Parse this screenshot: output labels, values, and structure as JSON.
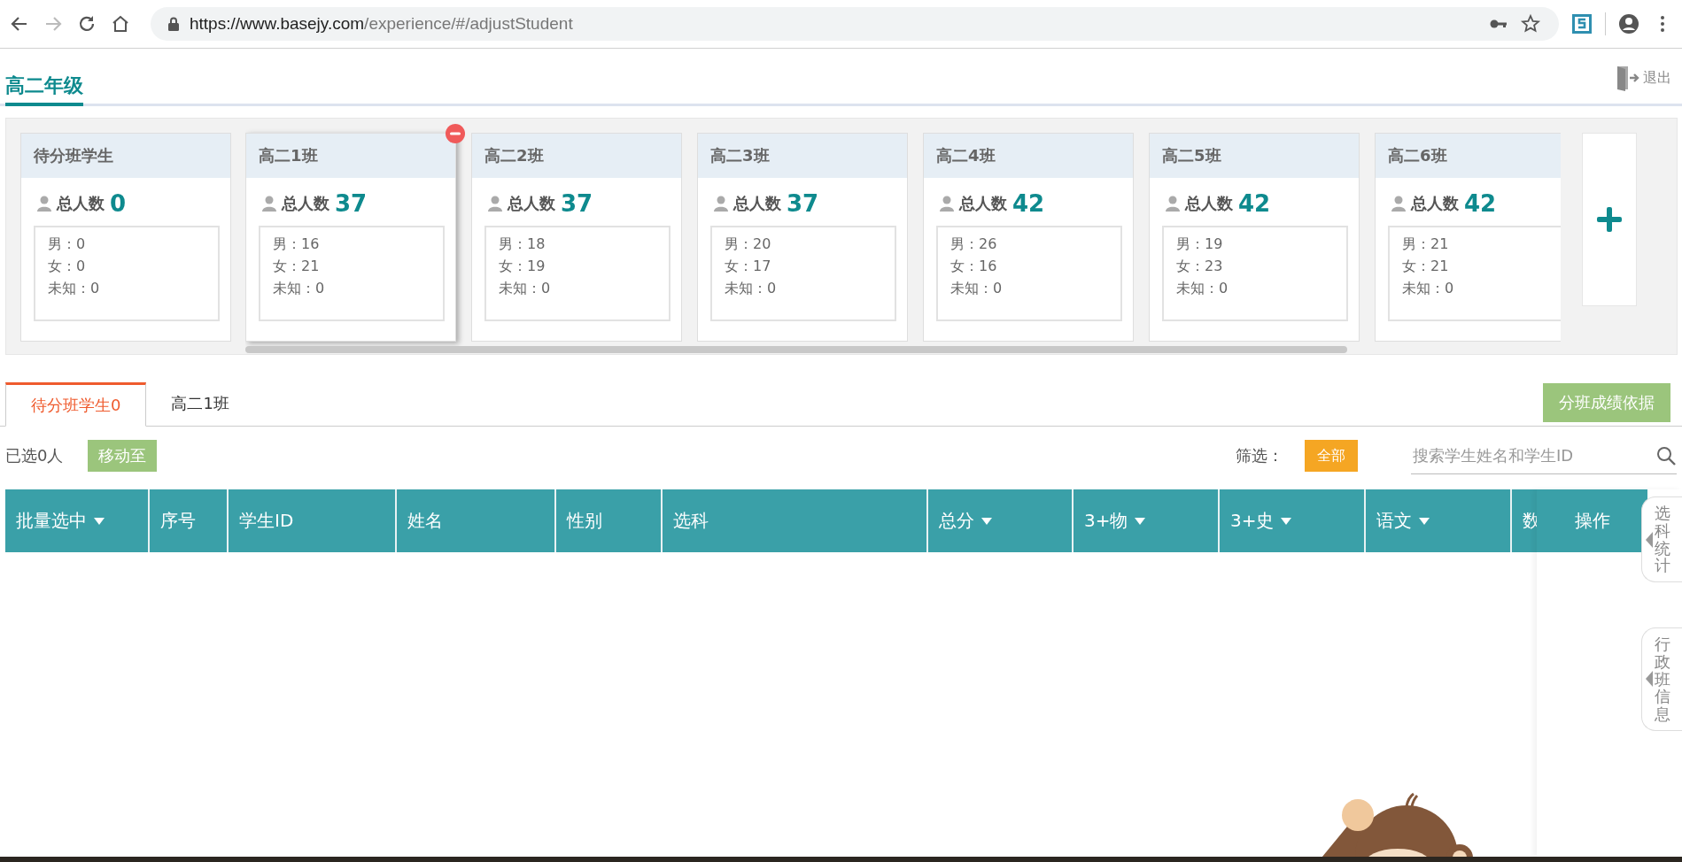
{
  "browser": {
    "url_host": "https://www.basejy.com",
    "url_path": "/experience/#/adjustStudent",
    "forward_disabled": true
  },
  "header": {
    "title": "高二年级",
    "logout": "退出"
  },
  "fixed_card": {
    "name": "待分班学生",
    "total_label": "总人数",
    "total": "0",
    "stats": [
      "男：0",
      "女：0",
      "未知：0"
    ]
  },
  "class_cards": [
    {
      "name": "高二1班",
      "total_label": "总人数",
      "total": "37",
      "stats": [
        "男：16",
        "女：21",
        "未知：0"
      ],
      "hovered": true
    },
    {
      "name": "高二2班",
      "total_label": "总人数",
      "total": "37",
      "stats": [
        "男：18",
        "女：19",
        "未知：0"
      ],
      "hovered": false
    },
    {
      "name": "高二3班",
      "total_label": "总人数",
      "total": "37",
      "stats": [
        "男：20",
        "女：17",
        "未知：0"
      ],
      "hovered": false
    },
    {
      "name": "高二4班",
      "total_label": "总人数",
      "total": "42",
      "stats": [
        "男：26",
        "女：16",
        "未知：0"
      ],
      "hovered": false
    },
    {
      "name": "高二5班",
      "total_label": "总人数",
      "total": "42",
      "stats": [
        "男：19",
        "女：23",
        "未知：0"
      ],
      "hovered": false
    },
    {
      "name": "高二6班",
      "total_label": "总人数",
      "total": "42",
      "stats": [
        "男：21",
        "女：21",
        "未知：0"
      ],
      "hovered": false
    }
  ],
  "tabs": [
    {
      "label": "待分班学生0",
      "selected": true
    },
    {
      "label": "高二1班",
      "selected": false
    }
  ],
  "score_basis_button": "分班成绩依据",
  "toolbar": {
    "selected_count": "已选0人",
    "move_button": "移动至",
    "filter_label": "筛选：",
    "filter_chip": "全部",
    "search_placeholder": "搜索学生姓名和学生ID"
  },
  "table": {
    "columns": [
      {
        "label": "批量选中",
        "sortable": true
      },
      {
        "label": "序号",
        "sortable": false
      },
      {
        "label": "学生ID",
        "sortable": false
      },
      {
        "label": "姓名",
        "sortable": false
      },
      {
        "label": "性别",
        "sortable": false
      },
      {
        "label": "选科",
        "sortable": false
      },
      {
        "label": "总分",
        "sortable": true
      },
      {
        "label": "3+物",
        "sortable": true
      },
      {
        "label": "3+史",
        "sortable": true
      },
      {
        "label": "语文",
        "sortable": true
      },
      {
        "label": "数"
      }
    ],
    "action_column": "操作"
  },
  "side_tabs": [
    "选科统计",
    "行政班信息"
  ]
}
